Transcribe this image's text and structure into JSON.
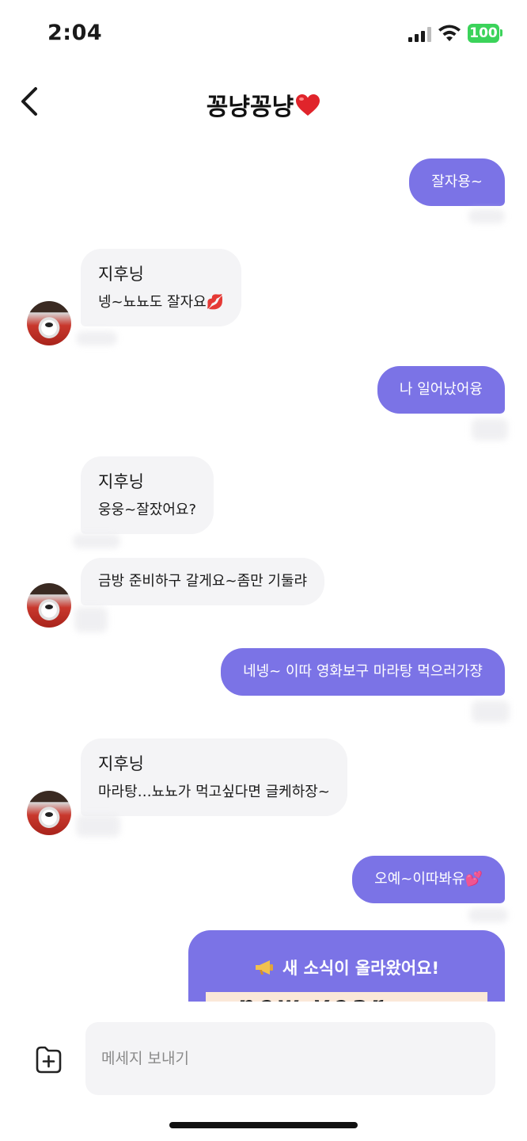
{
  "status_bar": {
    "time": "2:04",
    "battery": "100"
  },
  "header": {
    "title": "꽁냥꽁냥"
  },
  "messages": [
    {
      "type": "outgoing",
      "text": "잘자용~"
    },
    {
      "type": "incoming",
      "sender": "지후닝",
      "text": "넹~뇨뇨도 잘자요💋"
    },
    {
      "type": "outgoing",
      "text": "나 일어났어융"
    },
    {
      "type": "incoming",
      "sender": "지후닝",
      "text": "웅웅~잘잤어요?"
    },
    {
      "type": "incoming",
      "text": "금방 준비하구 갈게요~좀만 기둘랴"
    },
    {
      "type": "outgoing",
      "text": "네넹~ 이따 영화보구 마라탕 먹으러가쟝"
    },
    {
      "type": "incoming",
      "sender": "지후닝",
      "text": "마라탕…뇨뇨가 먹고싶다면 글케하장~"
    },
    {
      "type": "outgoing",
      "text": "오예~이따봐유💕"
    }
  ],
  "news_card": {
    "title": "새 소식이 올라왔어요!",
    "image_text": "new year"
  },
  "composer": {
    "placeholder": "메세지 보내기"
  },
  "colors": {
    "accent": "#7b73e6",
    "incoming_bubble": "#f4f4f6",
    "battery": "#3bd35a"
  }
}
